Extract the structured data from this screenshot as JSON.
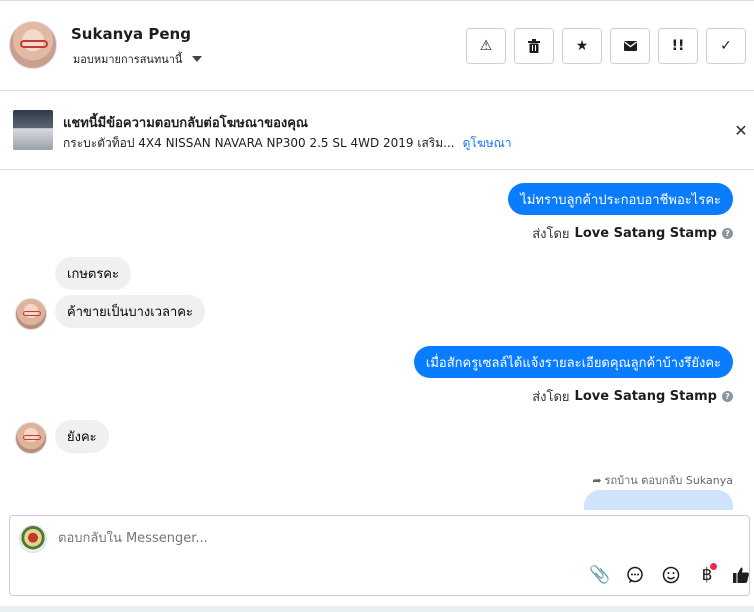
{
  "header": {
    "contact_name": "Sukanya Peng",
    "assign_label": "มอบหมายการสนทนานี้",
    "toolbar": [
      {
        "name": "spam-button",
        "icon": "warning-icon",
        "glyph": "⚠"
      },
      {
        "name": "delete-button",
        "icon": "trash-icon",
        "glyph": "🗑"
      },
      {
        "name": "star-button",
        "icon": "star-icon",
        "glyph": "★"
      },
      {
        "name": "mark-unread-button",
        "icon": "envelope-icon",
        "glyph": "✉"
      },
      {
        "name": "follow-up-button",
        "icon": "priority-icon",
        "glyph": "!!"
      },
      {
        "name": "done-button",
        "icon": "checkmark-icon",
        "glyph": "✓"
      }
    ]
  },
  "ad_banner": {
    "title": "แชทนี้มีข้อความตอบกลับต่อโฆษณาของคุณ",
    "subtitle": "กระบะตัวท็อป 4X4 NISSAN NAVARA NP300 2.5 SL 4WD 2019 เสริม...",
    "link_label": "ดูโฆษณา",
    "close_glyph": "✕"
  },
  "messages": {
    "m1": "ไม่ทราบลูกค้าประกอบอาชีพอะไรคะ",
    "sent_by_prefix": "ส่งโดย",
    "sender": "Love Satang Stamp",
    "help_glyph": "?",
    "m2": "เกษตรคะ",
    "m3": "ค้าขายเป็นบางเวลาคะ",
    "m4": "เมื่อสักครูเซลล์ได้แจ้งรายละเอียดคุณลูกค้าบ้างรึยังคะ",
    "m5": "ยังคะ",
    "reply_note": "รถบ้าน ตอบกลับ Sukanya",
    "reply_glyph": "➦"
  },
  "composer": {
    "placeholder": "ตอบกลับใน Messenger...",
    "icons": [
      {
        "name": "attachment-icon",
        "glyph": "📎"
      },
      {
        "name": "saved-replies-icon",
        "glyph": "💬"
      },
      {
        "name": "emoji-icon",
        "glyph": "☺"
      },
      {
        "name": "payment-icon",
        "glyph": "฿"
      },
      {
        "name": "like-icon",
        "glyph": "👍"
      }
    ]
  }
}
